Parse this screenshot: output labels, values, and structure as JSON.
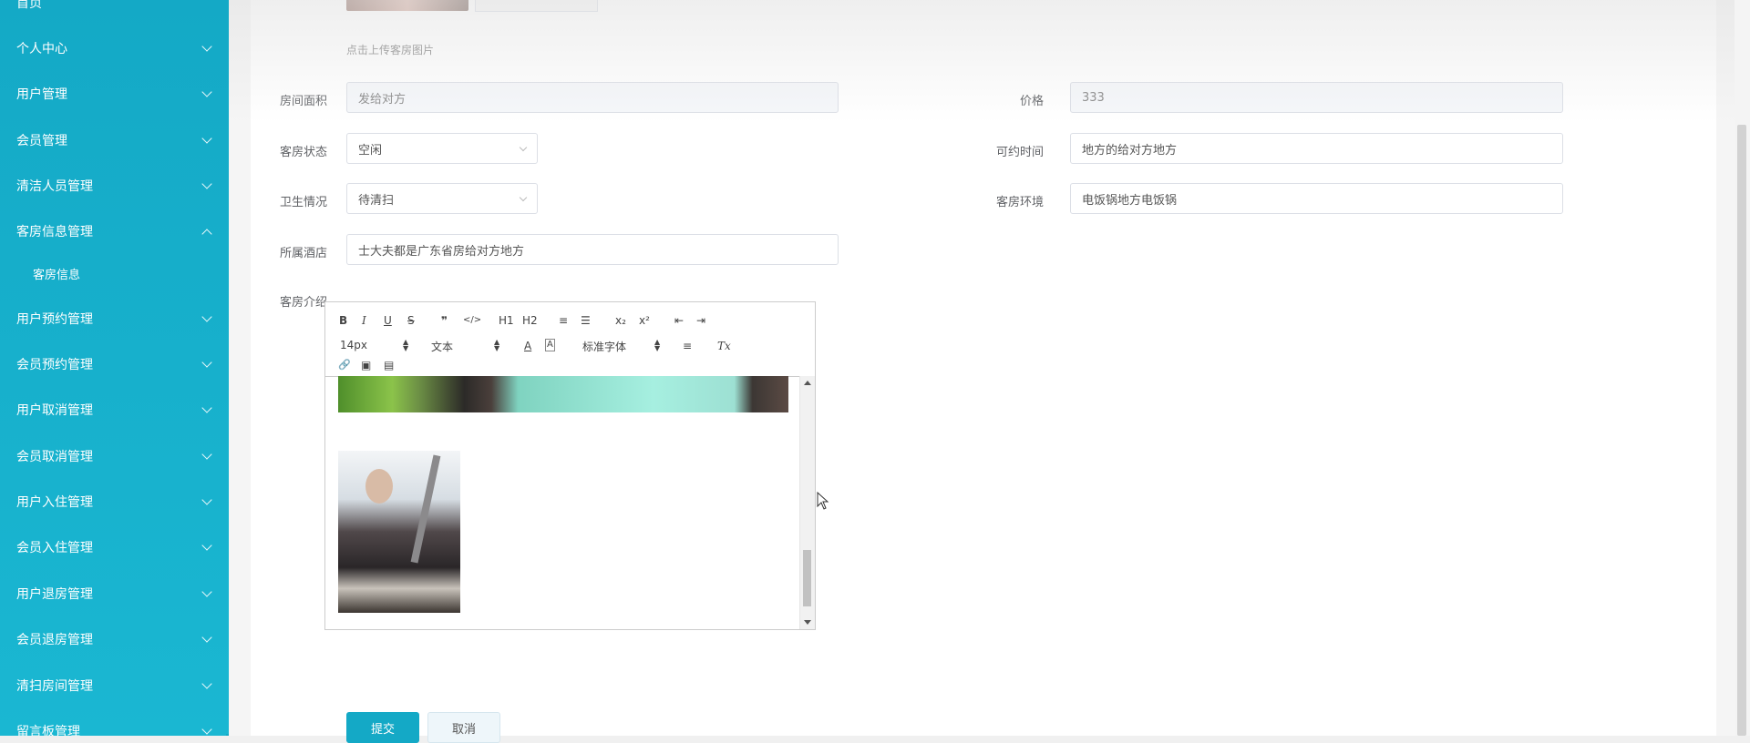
{
  "sidebar": {
    "items": [
      {
        "label": "首页",
        "expanded": false
      },
      {
        "label": "个人中心",
        "expanded": false
      },
      {
        "label": "用户管理",
        "expanded": false
      },
      {
        "label": "会员管理",
        "expanded": false
      },
      {
        "label": "清洁人员管理",
        "expanded": false
      },
      {
        "label": "客房信息管理",
        "expanded": true
      },
      {
        "label": "客房信息",
        "sub": true
      },
      {
        "label": "用户预约管理",
        "expanded": false
      },
      {
        "label": "会员预约管理",
        "expanded": false
      },
      {
        "label": "用户取消管理",
        "expanded": false
      },
      {
        "label": "会员取消管理",
        "expanded": false
      },
      {
        "label": "用户入住管理",
        "expanded": false
      },
      {
        "label": "会员入住管理",
        "expanded": false
      },
      {
        "label": "用户退房管理",
        "expanded": false
      },
      {
        "label": "会员退房管理",
        "expanded": false
      },
      {
        "label": "清扫房间管理",
        "expanded": false
      },
      {
        "label": "留言板管理",
        "expanded": false
      }
    ]
  },
  "form": {
    "upload_hint": "点击上传客房图片",
    "room_area": {
      "label": "房间面积",
      "value": "发给对方"
    },
    "price": {
      "label": "价格",
      "value": "333"
    },
    "room_status": {
      "label": "客房状态",
      "value": "空闲"
    },
    "available_time": {
      "label": "可约时间",
      "value": "地方的给对方地方"
    },
    "hygiene": {
      "label": "卫生情况",
      "value": "待清扫"
    },
    "environment": {
      "label": "客房环境",
      "value": "电饭锅地方电饭锅"
    },
    "hotel": {
      "label": "所属酒店",
      "value": "士大夫都是广东省房给对方地方"
    },
    "intro": {
      "label": "客房介绍"
    }
  },
  "editor": {
    "toolbar": {
      "bold": "B",
      "italic": "I",
      "underline": "U",
      "strike": "S",
      "quote": "❞",
      "code": "</>",
      "h1": "H1",
      "h2": "H2",
      "ordered_list": "≡",
      "bullet_list": "☰",
      "subscript": "x₂",
      "superscript": "x²",
      "outdent": "⇤",
      "indent": "⇥",
      "size": "14px",
      "header": "文本",
      "font": "标准字体",
      "color": "A",
      "background": "A",
      "align": "≡",
      "clean": "Tx",
      "link": "🔗",
      "image": "▣",
      "video": "▤"
    }
  },
  "buttons": {
    "submit": "提交",
    "cancel": "取消"
  },
  "colors": {
    "sidebar": "#14a9c6",
    "primary": "#14a9c6"
  }
}
